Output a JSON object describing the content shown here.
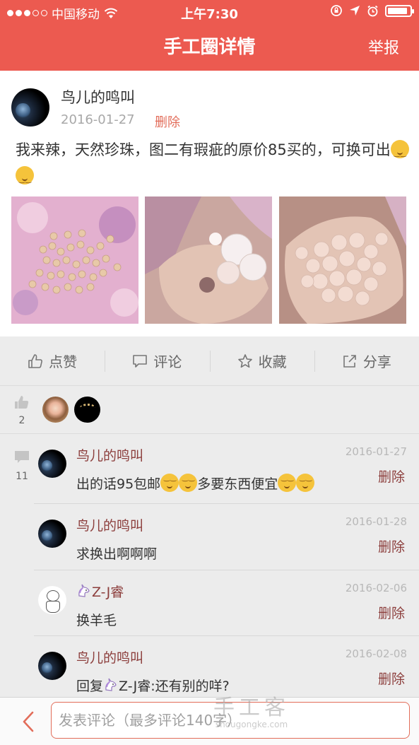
{
  "status_bar": {
    "carrier": "中国移动",
    "time": "上午7:30",
    "battery_level": 0.9
  },
  "nav": {
    "title": "手工圈详情",
    "report_label": "举报"
  },
  "post": {
    "author": "鸟儿的鸣叫",
    "date": "2016-01-27",
    "delete_label": "删除",
    "text": "我来辣，天然珍珠，图二有瑕疵的原价85买的，可换可出",
    "photos": [
      "photo-icon",
      "photo-icon",
      "photo-icon"
    ]
  },
  "actions": {
    "like": "点赞",
    "comment": "评论",
    "favorite": "收藏",
    "share": "分享"
  },
  "likes": {
    "count": "2"
  },
  "comments": {
    "count": "11",
    "items": [
      {
        "user": "鸟儿的鸣叫",
        "date": "2016-01-27",
        "text_a": "出的话95包邮",
        "text_b": "多要东西便宜",
        "delete_label": "删除"
      },
      {
        "user": "鸟儿的鸣叫",
        "date": "2016-01-28",
        "text": "求换出啊啊啊",
        "delete_label": "删除"
      },
      {
        "user": "Z-J睿",
        "date": "2016-02-06",
        "text": "换羊毛",
        "delete_label": "删除"
      },
      {
        "user": "鸟儿的鸣叫",
        "date": "2016-02-08",
        "text_prefix": "回复",
        "text_user": "Z-J睿",
        "text_rest": ":还有别的咩?",
        "delete_label": "删除"
      }
    ]
  },
  "input": {
    "placeholder": "发表评论（最多评论140字）"
  },
  "watermark": {
    "main": "手工客",
    "url": "shougongke.com"
  },
  "colors": {
    "brand": "#ec5a50",
    "username": "#8c3e3c",
    "delete": "#e26d5a"
  }
}
